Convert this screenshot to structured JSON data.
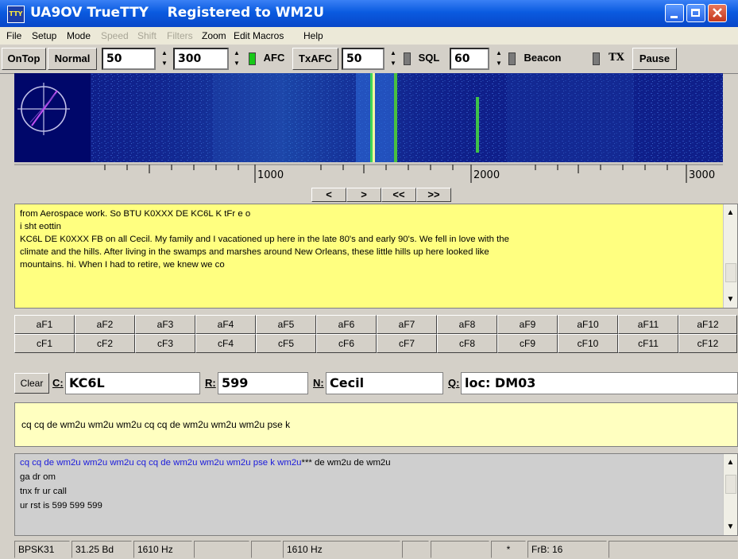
{
  "window": {
    "title": "UA9OV TrueTTY    Registered to WM2U",
    "icon_text": "TTY",
    "controls": [
      "minimize-icon",
      "maximize-icon",
      "close-icon"
    ]
  },
  "menu": {
    "items": [
      {
        "label": "File",
        "enabled": true
      },
      {
        "label": "Setup",
        "enabled": true
      },
      {
        "label": "Mode",
        "enabled": true
      },
      {
        "label": "Speed",
        "enabled": false
      },
      {
        "label": "Shift",
        "enabled": false
      },
      {
        "label": "Filters",
        "enabled": false
      },
      {
        "label": "Zoom",
        "enabled": true
      },
      {
        "label": "Edit Macros",
        "enabled": true
      },
      {
        "label": "Help",
        "enabled": true
      }
    ]
  },
  "toolbar": {
    "ontop": "OnTop",
    "normal": "Normal",
    "spin1": "50",
    "spin2": "300",
    "afc": "AFC",
    "afc_on": true,
    "txafc": "TxAFC",
    "spin3": "50",
    "sql": "SQL",
    "sql_on": false,
    "spin4": "60",
    "beacon": "Beacon",
    "beacon_on": false,
    "tx": "TX",
    "tx_on": false,
    "pause": "Pause"
  },
  "scale": {
    "labels": [
      "1000",
      "2000",
      "3000"
    ]
  },
  "nav": [
    "<",
    ">",
    "<<",
    ">>"
  ],
  "rx": {
    "lines": [
      "from Aerospace  work. So  BTU K0XXX DE KC6L K tFr e o",
      " i sht eottin",
      " KC6L DE K0XXX   FB on all Cecil.   My family and I vacationed up here in the late 80's and early 90's.  We fell in love with the",
      "climate and the hills.  After living in the swamps and marshes around New Orleans, these little hills up here looked like",
      "mountains. hi.   When I had to retire, we knew we co"
    ]
  },
  "macros": {
    "row1": [
      "aF1",
      "aF2",
      "aF3",
      "aF4",
      "aF5",
      "aF6",
      "aF7",
      "aF8",
      "aF9",
      "aF10",
      "aF11",
      "aF12"
    ],
    "row2": [
      "cF1",
      "cF2",
      "cF3",
      "cF4",
      "cF5",
      "cF6",
      "cF7",
      "cF8",
      "cF9",
      "cF10",
      "cF11",
      "cF12"
    ]
  },
  "qso": {
    "clear_label": "Clear",
    "call_label": "C:",
    "call_value": "KC6L",
    "rst_label": "R:",
    "rst_value": "599",
    "name_label": "N:",
    "name_value": "Cecil",
    "qth_label": "Q:",
    "qth_value": "loc: DM03"
  },
  "tx": {
    "text": "cq cq de wm2u wm2u wm2u cq cq de wm2u wm2u wm2u pse k"
  },
  "log": {
    "line1_sent": "cq cq de wm2u wm2u wm2u cq cq de wm2u wm2u wm2u pse k wm2u",
    "line1_rest": "*** de wm2u  de wm2u",
    "lines": [
      "ga dr om",
      "tnx fr ur call",
      "ur rst is 599 599 599"
    ],
    "sent_color": "#1a1adb"
  },
  "status": {
    "mode": "BPSK31",
    "baud": "31.25 Bd",
    "freq1": "1610 Hz",
    "freq2": "1610 Hz",
    "star": "*",
    "fb": "FrB: 16"
  },
  "colors": {
    "rx_bg": "#ffff80",
    "tx_bg": "#ffffc0",
    "waterfall_bg": "#0f1f8a",
    "led_on": "#18c818"
  }
}
